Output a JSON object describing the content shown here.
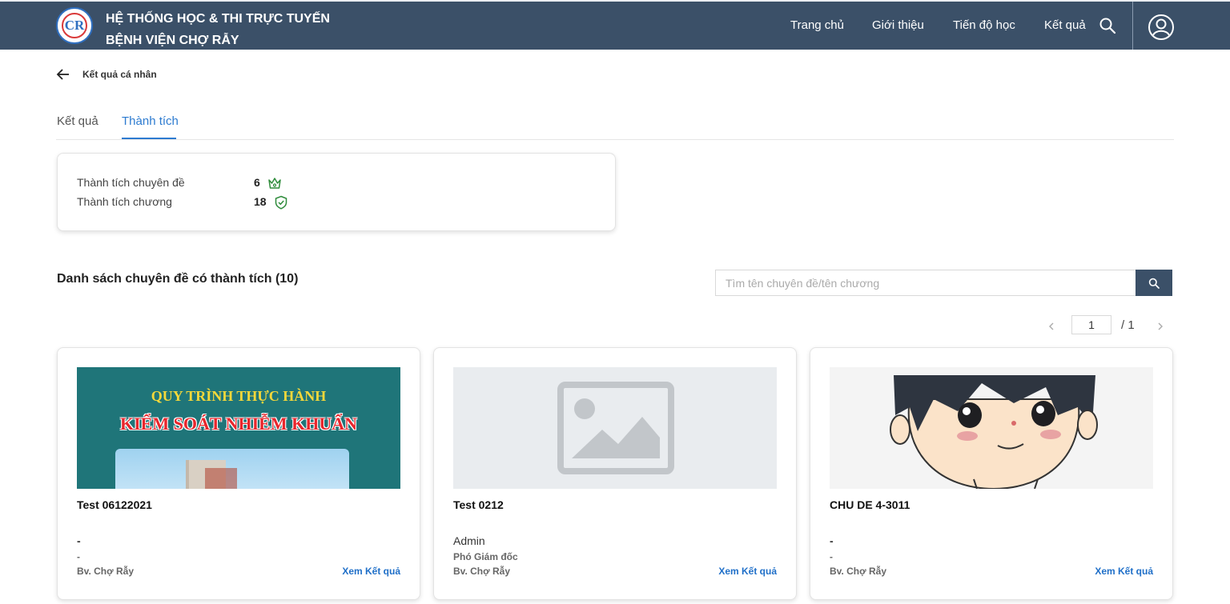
{
  "header": {
    "logo_text": "CR",
    "brand_line1": "HỆ THỐNG HỌC & THI TRỰC TUYẾN",
    "brand_line2": "BỆNH VIỆN CHỢ RẪY",
    "nav": [
      "Trang chủ",
      "Giới thiệu",
      "Tiến độ học",
      "Kết quả"
    ],
    "icons": {
      "search": "search-icon",
      "user": "user-circle-icon"
    }
  },
  "breadcrumb": {
    "back_icon": "arrow-left-icon",
    "label": "Kết quả cá nhân"
  },
  "tabs": [
    {
      "label": "Kết quả",
      "active": false
    },
    {
      "label": "Thành tích",
      "active": true
    }
  ],
  "stats": {
    "topic_label": "Thành tích chuyên đề",
    "topic_value": "6",
    "topic_icon": "crown-icon",
    "chapter_label": "Thành tích chương",
    "chapter_value": "18",
    "chapter_icon": "shield-check-icon",
    "icon_color": "#2e8b3a"
  },
  "list": {
    "title": "Danh sách chuyên đề có thành tích (10)",
    "search_placeholder": "Tìm tên chuyên đề/tên chương",
    "search_value": ""
  },
  "pager": {
    "current": "1",
    "total": "/ 1"
  },
  "cards": [
    {
      "thumb_line1": "QUY TRÌNH THỰC HÀNH",
      "thumb_line2": "KIỂM SOÁT NHIỄM KHUẨN",
      "title": "Test 06122021",
      "author": "-",
      "role": "-",
      "org": "Bv. Chợ Rẫy",
      "link": "Xem Kết quả"
    },
    {
      "thumb_icon": "image-placeholder-icon",
      "title": "Test 0212",
      "author": "Admin",
      "role": "Phó Giám đốc",
      "org": "Bv. Chợ Rẫy",
      "link": "Xem Kết quả"
    },
    {
      "thumb_icon": "cartoon-face-image",
      "title": "CHU DE 4-3011",
      "author": "-",
      "role": "-",
      "org": "Bv. Chợ Rẫy",
      "link": "Xem Kết quả"
    }
  ],
  "colors": {
    "header_bg": "#3b5068",
    "accent": "#2d7bd0",
    "link": "#1f6fc8"
  }
}
